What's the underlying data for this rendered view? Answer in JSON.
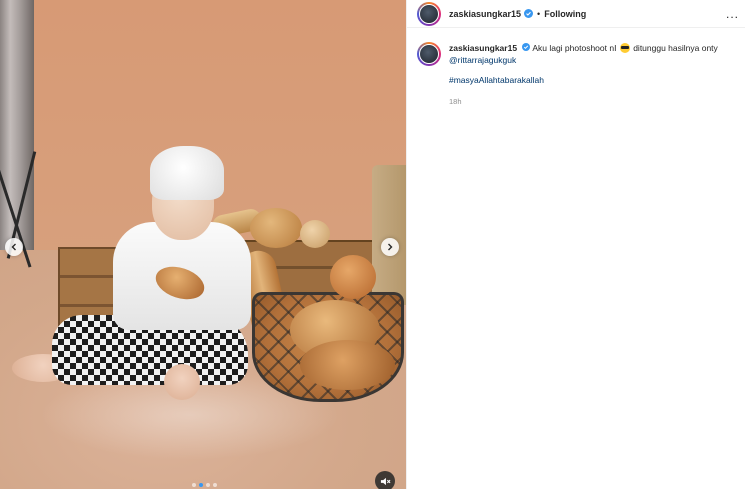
{
  "post": {
    "username": "zaskiasungkar15",
    "follow_status": "Following",
    "separator": "•",
    "more_label": "..."
  },
  "caption": {
    "username": "zaskiasungkar15",
    "text_part1": "Aku lagi photoshoot nI",
    "emoji": "sunglasses-emoji",
    "text_part2": "ditunggu hasilnya onty",
    "mention": "@rittarrajagukguk",
    "hashtag": "#masyaAllahtabarakallah",
    "time_ago": "18h"
  },
  "media": {
    "nav_prev": "‹",
    "nav_next": "›",
    "carousel_total": 4,
    "carousel_active": 2
  },
  "colors": {
    "link": "#00376b",
    "verified": "#3897f0",
    "backdrop": "#d79a75"
  }
}
